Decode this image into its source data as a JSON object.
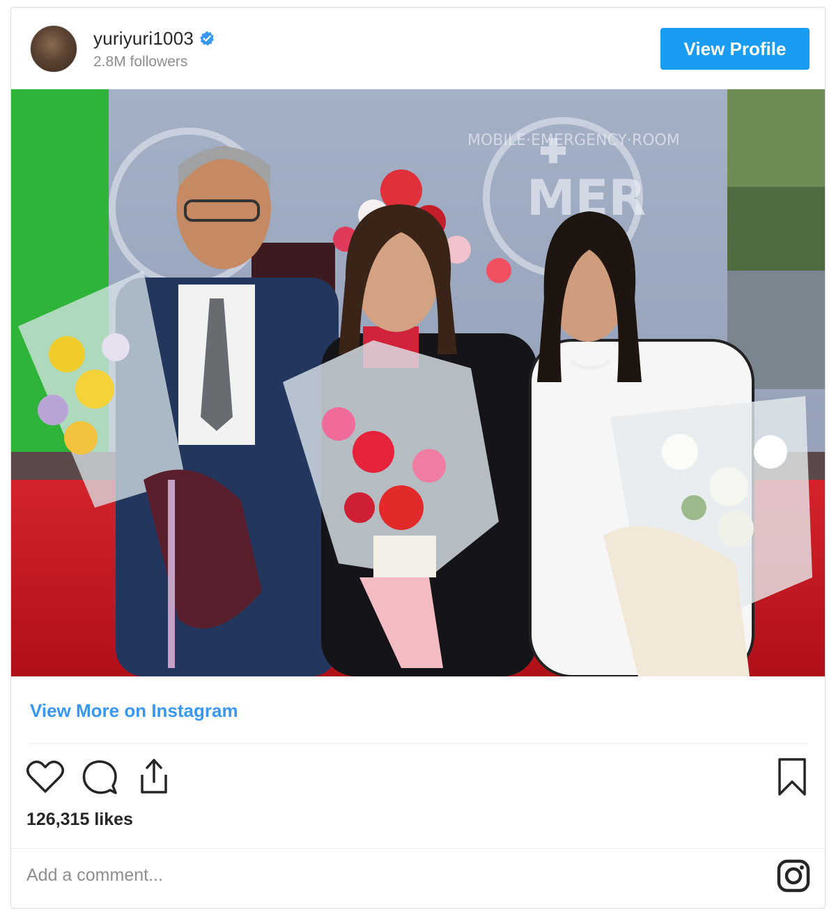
{
  "header": {
    "username": "yuriyuri1003",
    "followers": "2.8M followers",
    "view_profile_label": "View Profile"
  },
  "post": {
    "view_more_label": "View More on Instagram",
    "likes": "126,315 likes",
    "comment_placeholder": "Add a comment..."
  },
  "photo": {
    "backdrop_text": "MOBILE·EMERGENCY·ROOM",
    "logo_text": "MER"
  },
  "colors": {
    "accent": "#1a9cf2",
    "link": "#3897f0",
    "verified": "#3897f0"
  },
  "icons": [
    "heart-icon",
    "comment-icon",
    "share-icon",
    "bookmark-icon",
    "instagram-icon",
    "verified-badge-icon"
  ]
}
